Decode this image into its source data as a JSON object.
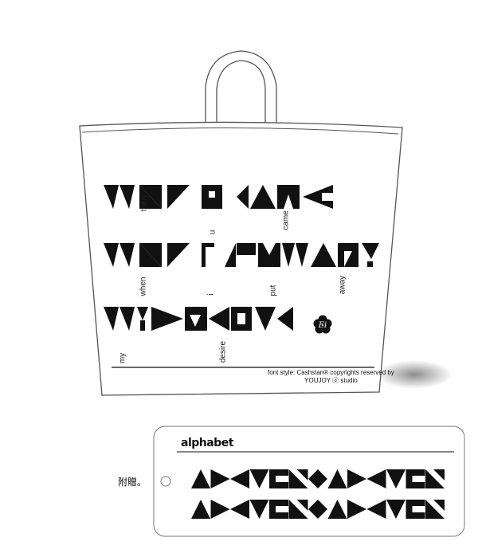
{
  "bag": {
    "rotated_words": [
      "then",
      "u",
      "came",
      "when",
      "i",
      "put",
      "away",
      "my",
      "desire"
    ],
    "credit_line1": "font style: Cashstan® copyrights reserved by",
    "credit_line2": "YOUJOY ⓓ studio",
    "logo_letter": "Ei"
  },
  "tag": {
    "label": "附贈。",
    "title": "alphabet",
    "row1": [
      "a",
      "b",
      "c",
      "d",
      "e",
      "f",
      "g",
      "h",
      "i",
      "j",
      "k",
      "l",
      "m"
    ],
    "row2": [
      "n",
      "o",
      "p",
      "q",
      "r",
      "s",
      "t",
      "u",
      "v",
      "w",
      "x",
      "y",
      "z"
    ]
  },
  "colors": {
    "ink": "#111111",
    "outline": "#555555",
    "background": "#ffffff"
  }
}
